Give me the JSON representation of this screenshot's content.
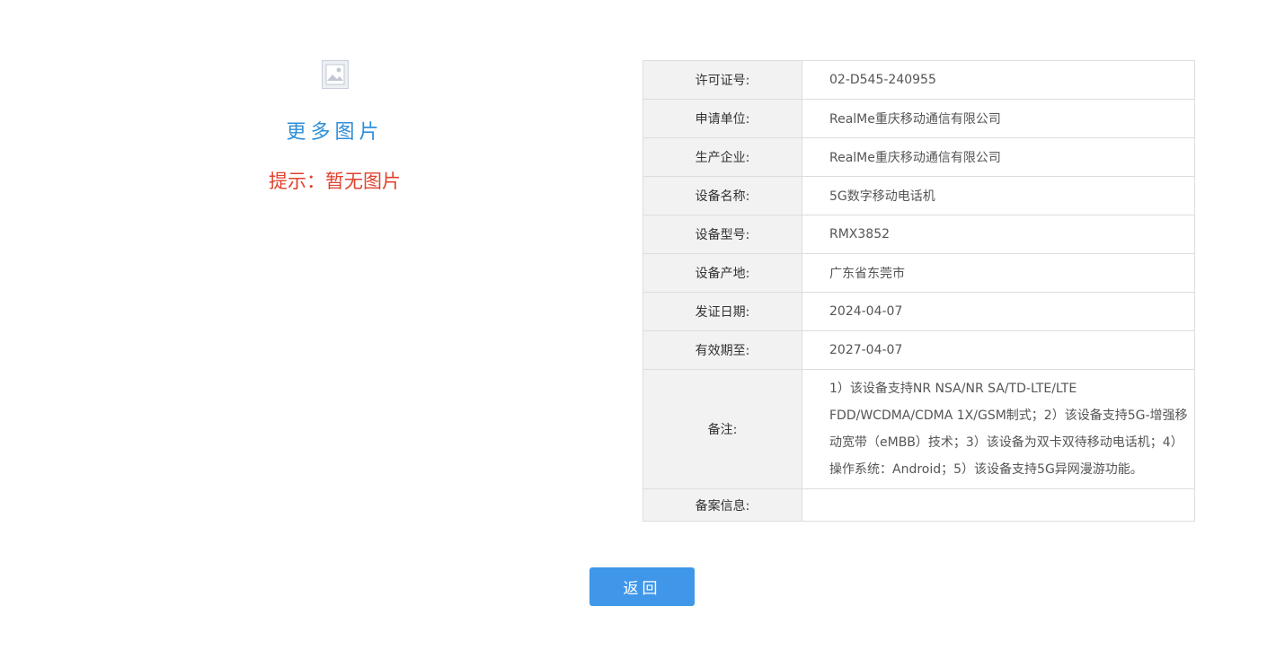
{
  "left_panel": {
    "image_icon": "image-placeholder-icon",
    "more_images": "更多图片",
    "tip": "提示：暂无图片"
  },
  "table": {
    "rows": [
      {
        "label": "许可证号:",
        "value": "02-D545-240955"
      },
      {
        "label": "申请单位:",
        "value": "RealMe重庆移动通信有限公司"
      },
      {
        "label": "生产企业:",
        "value": "RealMe重庆移动通信有限公司"
      },
      {
        "label": "设备名称:",
        "value": "5G数字移动电话机"
      },
      {
        "label": "设备型号:",
        "value": "RMX3852"
      },
      {
        "label": "设备产地:",
        "value": "广东省东莞市"
      },
      {
        "label": "发证日期:",
        "value": "2024-04-07"
      },
      {
        "label": "有效期至:",
        "value": "2027-04-07"
      },
      {
        "label": "备注:",
        "value": "1）该设备支持NR NSA/NR SA/TD-LTE/LTE FDD/WCDMA/CDMA 1X/GSM制式；2）该设备支持5G-增强移动宽带（eMBB）技术；3）该设备为双卡双待移动电话机；4）操作系统：Android；5）该设备支持5G异网漫游功能。"
      },
      {
        "label": "备案信息:",
        "value": ""
      }
    ]
  },
  "back_button": {
    "label": "返回"
  },
  "colors": {
    "link_blue": "#2f8fd8",
    "tip_red": "#e0422e",
    "button_blue": "#4097e9",
    "label_bg": "#f2f2f2"
  }
}
